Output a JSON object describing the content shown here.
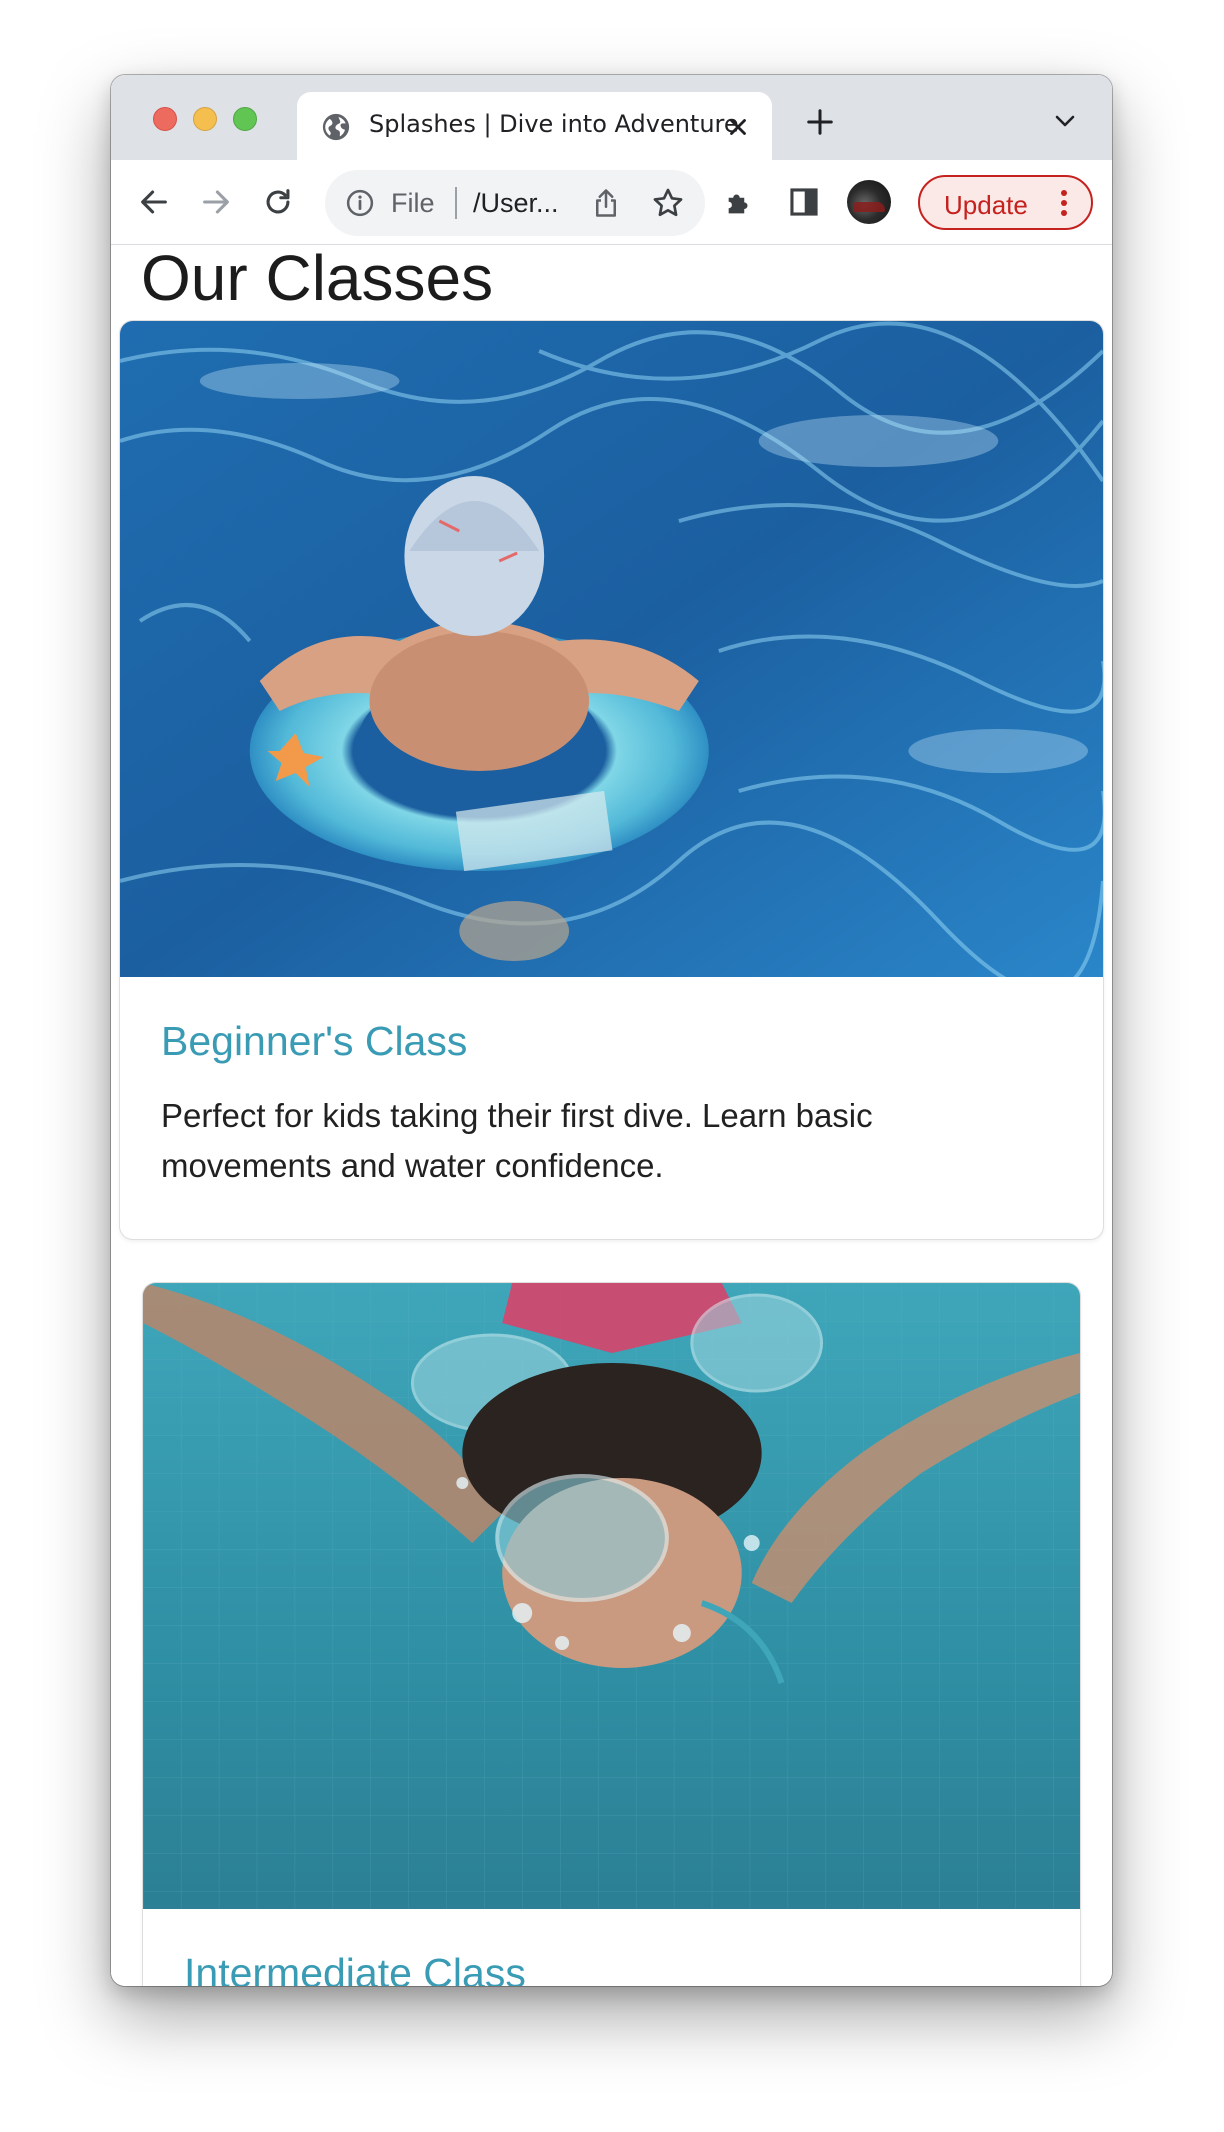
{
  "browser": {
    "tab": {
      "title": "Splashes | Dive into Adventure"
    },
    "omnibox": {
      "scheme": "File",
      "url": "/User..."
    },
    "update_button": {
      "label": "Update"
    },
    "colors": {
      "update_accent": "#c5221f",
      "tabstrip": "#dee1e6"
    }
  },
  "page": {
    "heading": "Our Classes",
    "accent_color": "#3a9bb5",
    "classes": [
      {
        "title": "Beginner's Class",
        "description": "Perfect for kids taking their first dive. Learn basic movements and water confidence.",
        "photo": "child-in-swim-ring-photo"
      },
      {
        "title": "Intermediate Class",
        "photo": "girl-swimming-underwater-photo"
      }
    ]
  }
}
